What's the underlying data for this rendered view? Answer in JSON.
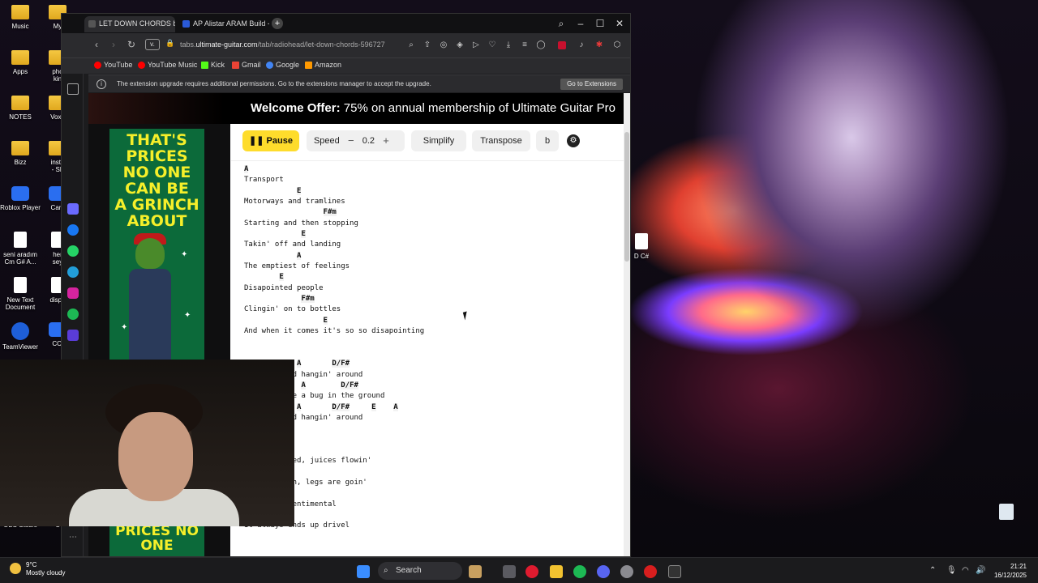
{
  "desktop": {
    "icons": [
      {
        "label": "Music",
        "kind": "folder"
      },
      {
        "label": "My",
        "kind": "folder"
      },
      {
        "label": "Apps",
        "kind": "folder"
      },
      {
        "label": "pho\nkin",
        "kind": "folder"
      },
      {
        "label": "NOTES",
        "kind": "folder"
      },
      {
        "label": "Voxe",
        "kind": "folder"
      },
      {
        "label": "Bizz",
        "kind": "folder"
      },
      {
        "label": "insta\n- Sh",
        "kind": "folder"
      },
      {
        "label": "Roblox Player",
        "kind": "blue"
      },
      {
        "label": "Cam",
        "kind": "blue"
      },
      {
        "label": "seni aradım\nCm G# A...",
        "kind": "doc"
      },
      {
        "label": "her\nsey",
        "kind": "doc"
      },
      {
        "label": "New Text\nDocument",
        "kind": "doc"
      },
      {
        "label": "dispo",
        "kind": "doc"
      },
      {
        "label": "TeamViewer",
        "kind": "tv"
      },
      {
        "label": "CCl",
        "kind": "blue"
      },
      {
        "label": "OBS Studio",
        "kind": "blue"
      },
      {
        "label": "C",
        "kind": "blue"
      }
    ],
    "side_doc_label": "D C#"
  },
  "browser": {
    "tabs": [
      {
        "label": "LET DOWN CHORDS by R",
        "active": true
      },
      {
        "label": "AP Alistar ARAM Build - U",
        "active": false
      }
    ],
    "new_tab": "+",
    "url_prefix": "tabs.",
    "url_domain": "ultimate-guitar.com",
    "url_path": "/tab/radiohead/let-down-chords-596727",
    "address_tag": "v.",
    "bookmarks": [
      {
        "label": "YouTube",
        "color": "#ff0000"
      },
      {
        "label": "YouTube Music",
        "color": "#ff0000"
      },
      {
        "label": "Kick",
        "color": "#53fc18"
      },
      {
        "label": "Gmail",
        "color": "#ea4335"
      },
      {
        "label": "Google",
        "color": "#4285f4"
      },
      {
        "label": "Amazon",
        "color": "#ff9900"
      }
    ],
    "infobar": {
      "message": "The extension upgrade requires additional permissions. Go to the extensions manager to accept the upgrade.",
      "button": "Go to Extensions"
    }
  },
  "page": {
    "banner_bold": "Welcome Offer:",
    "banner_rest": " 75% on annual membership of Ultimate Guitar Pro",
    "ad_text": "THAT'S\nPRICES\nNO ONE\nCAN BE\nA GRINCH\nABOUT",
    "ad2_text": "PRICES\nNO ONE",
    "toolbar": {
      "pause": "Pause",
      "speed": "Speed",
      "speed_value": "0.2",
      "minus": "−",
      "plus": "+",
      "simplify": "Simplify",
      "transpose": "Transpose",
      "more": "b"
    },
    "sheet": [
      {
        "c": true,
        "t": "A"
      },
      {
        "c": false,
        "t": "Transport"
      },
      {
        "c": true,
        "t": "            E"
      },
      {
        "c": false,
        "t": "Motorways and tramlines"
      },
      {
        "c": true,
        "t": "                  F#m"
      },
      {
        "c": false,
        "t": "Starting and then stopping"
      },
      {
        "c": true,
        "t": "             E"
      },
      {
        "c": false,
        "t": "Takin' off and landing"
      },
      {
        "c": true,
        "t": "            A"
      },
      {
        "c": false,
        "t": "The emptiest of feelings"
      },
      {
        "c": true,
        "t": "        E"
      },
      {
        "c": false,
        "t": "Disapointed people"
      },
      {
        "c": true,
        "t": "             F#m"
      },
      {
        "c": false,
        "t": "Clingin' on to bottles"
      },
      {
        "c": true,
        "t": "                  E"
      },
      {
        "c": false,
        "t": "And when it comes it's so so disapointing"
      },
      {
        "c": false,
        "t": " "
      },
      {
        "c": false,
        "t": " "
      },
      {
        "c": true,
        "t": "            A       D/F#"
      },
      {
        "c": false,
        "t": "Let down and hangin' around"
      },
      {
        "c": true,
        "t": "          2  A        D/F#"
      },
      {
        "c": false,
        "t": "Crushed like a bug in the ground"
      },
      {
        "c": true,
        "t": "            A       D/F#     E    A"
      },
      {
        "c": false,
        "t": "Let down and hangin' around"
      },
      {
        "c": false,
        "t": " "
      },
      {
        "c": false,
        "t": " "
      },
      {
        "c": false,
        "t": " "
      },
      {
        "c": false,
        "t": "Shell smashed, juices flowin'"
      },
      {
        "c": false,
        "t": " "
      },
      {
        "c": false,
        "t": "Wings twitch, legs are goin'"
      },
      {
        "c": false,
        "t": " "
      },
      {
        "c": false,
        "t": "Don't get sentimental"
      },
      {
        "c": true,
        "t": "E"
      },
      {
        "c": false,
        "t": "It always ends up drivel"
      }
    ]
  },
  "taskbar": {
    "weather_temp": "9°C",
    "weather_desc": "Mostly cloudy",
    "search": "Search",
    "time": "21:21",
    "date": "16/12/2025"
  }
}
